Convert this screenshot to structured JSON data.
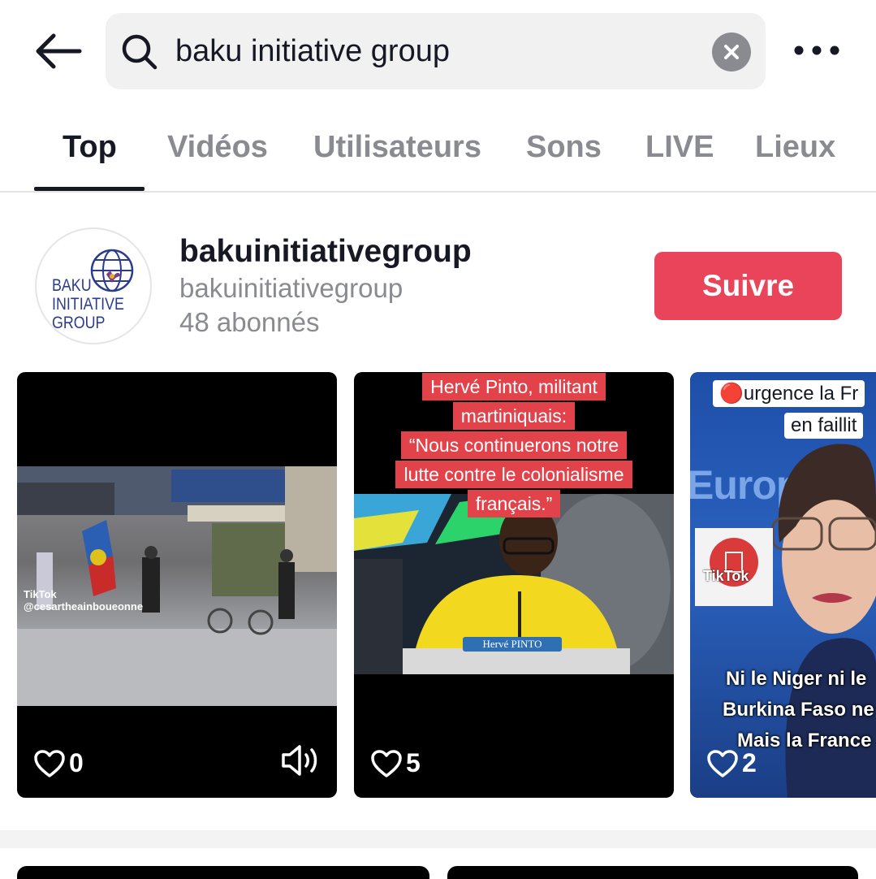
{
  "search": {
    "query": "baku initiative group"
  },
  "tabs": [
    {
      "label": "Top",
      "active": true
    },
    {
      "label": "Vidéos"
    },
    {
      "label": "Utilisateurs"
    },
    {
      "label": "Sons"
    },
    {
      "label": "LIVE"
    },
    {
      "label": "Lieux"
    }
  ],
  "user": {
    "name": "bakuinitiativegroup",
    "handle": "bakuinitiativegroup",
    "followers": "48 abonnés",
    "follow_label": "Suivre",
    "avatar_logo_lines": [
      "BAKU",
      "INITIATIVE",
      "GROUP"
    ]
  },
  "videos": [
    {
      "likes": "0",
      "watermark_brand": "TikTok",
      "watermark_handle": "@cesartheainboueonne"
    },
    {
      "likes": "5",
      "caption_lines": [
        "Hervé Pinto, militant",
        "martiniquais:",
        "“Nous continuerons notre",
        "lutte contre le colonialisme",
        "français.”"
      ],
      "nameplate": "Hervé PINTO"
    },
    {
      "likes": "2",
      "top_line1": "🔴urgence la Fr",
      "top_line2": "en faillit",
      "bg_text": "Europ",
      "watermark_brand": "TikTok",
      "subtitle_lines": [
        "Ni le Niger ni le",
        "Burkina Faso ne",
        "Mais la France"
      ]
    }
  ],
  "colors": {
    "accent": "#ea445a",
    "text": "#161823",
    "muted": "#8a8b91"
  }
}
